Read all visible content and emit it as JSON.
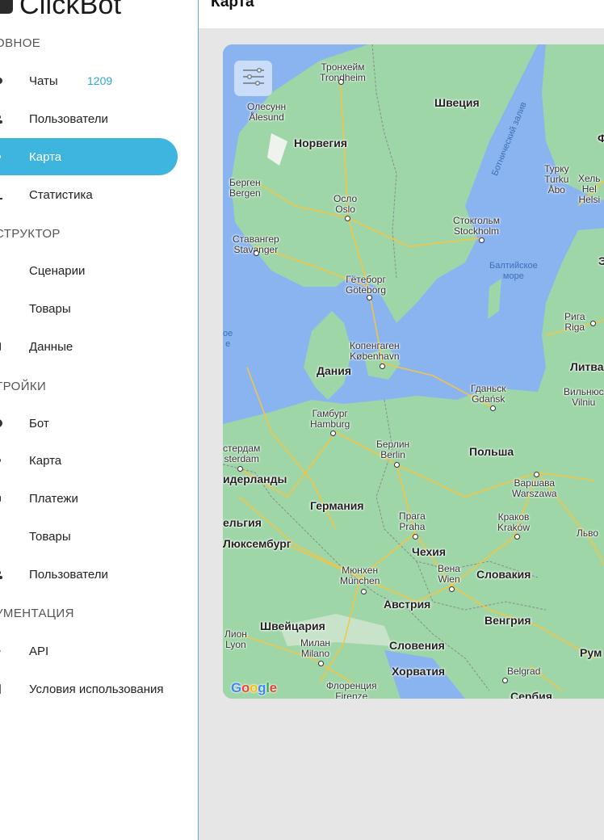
{
  "sidebar": {
    "logo_text": "ClickBot",
    "sections": [
      {
        "title": "ОВНОЕ",
        "items": [
          {
            "label": "Чаты",
            "badge": "1209",
            "icon": "chat-icon"
          },
          {
            "label": "Пользователи",
            "icon": "user-icon"
          },
          {
            "label": "Карта",
            "icon": "map-pin-icon",
            "active": true
          },
          {
            "label": "Статистика",
            "icon": "chart-icon"
          }
        ]
      },
      {
        "title": "СТРУКТОР",
        "items": [
          {
            "label": "Сценарии",
            "icon": "scenario-icon"
          },
          {
            "label": "Товары",
            "icon": "products-icon"
          },
          {
            "label": "Данные",
            "icon": "database-icon"
          }
        ]
      },
      {
        "title": "ТРОЙКИ",
        "items": [
          {
            "label": "Бот",
            "icon": "bot-icon"
          },
          {
            "label": "Карта",
            "icon": "map-pin-icon"
          },
          {
            "label": "Платежи",
            "icon": "payment-icon"
          },
          {
            "label": "Товары",
            "icon": "products-icon"
          },
          {
            "label": "Пользователи",
            "icon": "user-icon"
          }
        ]
      },
      {
        "title": "УМЕНТАЦИЯ",
        "items": [
          {
            "label": "API",
            "icon": "api-icon"
          },
          {
            "label": "Условия использования",
            "icon": "document-icon"
          }
        ]
      }
    ]
  },
  "header": {
    "title": "Карта"
  },
  "map": {
    "attribution": "Google",
    "labels": {
      "trondheim": "Тронхейм\nTrondheim",
      "sweden": "Швеция",
      "bothnian": "Ботнический залив",
      "alesund": "Олесунн\nÅlesund",
      "norway": "Норвегия",
      "turku": "Турку\nTurku\nÅbo",
      "helsinki": "Хель\nHel\nHelsi",
      "bergen": "Берген\nBergen",
      "oslo": "Осло\nOslo",
      "stockholm": "Стокгольм\nStockholm",
      "stavanger": "Ставангер\nStavanger",
      "baltic": "Балтийское\nморе",
      "goteborg": "Гётеборг\nGöteborg",
      "riga": "Рига\nRiga",
      "northsea": "ое\nе",
      "copenhagen": "Копенгаген\nKøbenhavn",
      "denmark": "Дания",
      "lithuania": "Литва",
      "vilnius": "Вильнюс\nVilniu",
      "gdansk": "Гданьск\nGdańsk",
      "hamburg": "Гамбург\nHamburg",
      "berlin": "Берлин\nBerlin",
      "poland": "Польша",
      "amsterdam": "стердам\nsterdam",
      "netherlands": "идерланды",
      "warsaw": "Варшава\nWarszawa",
      "germany": "Германия",
      "belgium": "ельгия",
      "prague": "Прага\nPraha",
      "krakow": "Краков\nKraków",
      "lviv": "Льво",
      "luxembourg": "Люксембург",
      "czechia": "Чехия",
      "munich": "Мюнхен\nMünchen",
      "vienna": "Вена\nWien",
      "slovakia": "Словакия",
      "austria": "Австрия",
      "hungary": "Венгрия",
      "switzerland": "Швейцария",
      "lyon": "Лион\nLyon",
      "milan": "Милан\nMilano",
      "slovenia": "Словения",
      "romania": "Рум",
      "croatia": "Хорватия",
      "belgrade": "Belgrad",
      "florence": "Флоренция\nFirenze",
      "serbia": "Сербия",
      "finland_f": "Ф",
      "estonia_e": "Э"
    },
    "colors": {
      "water": "#8ab4f0",
      "land": "#9fd6a8",
      "roads": "#f5c542"
    }
  }
}
